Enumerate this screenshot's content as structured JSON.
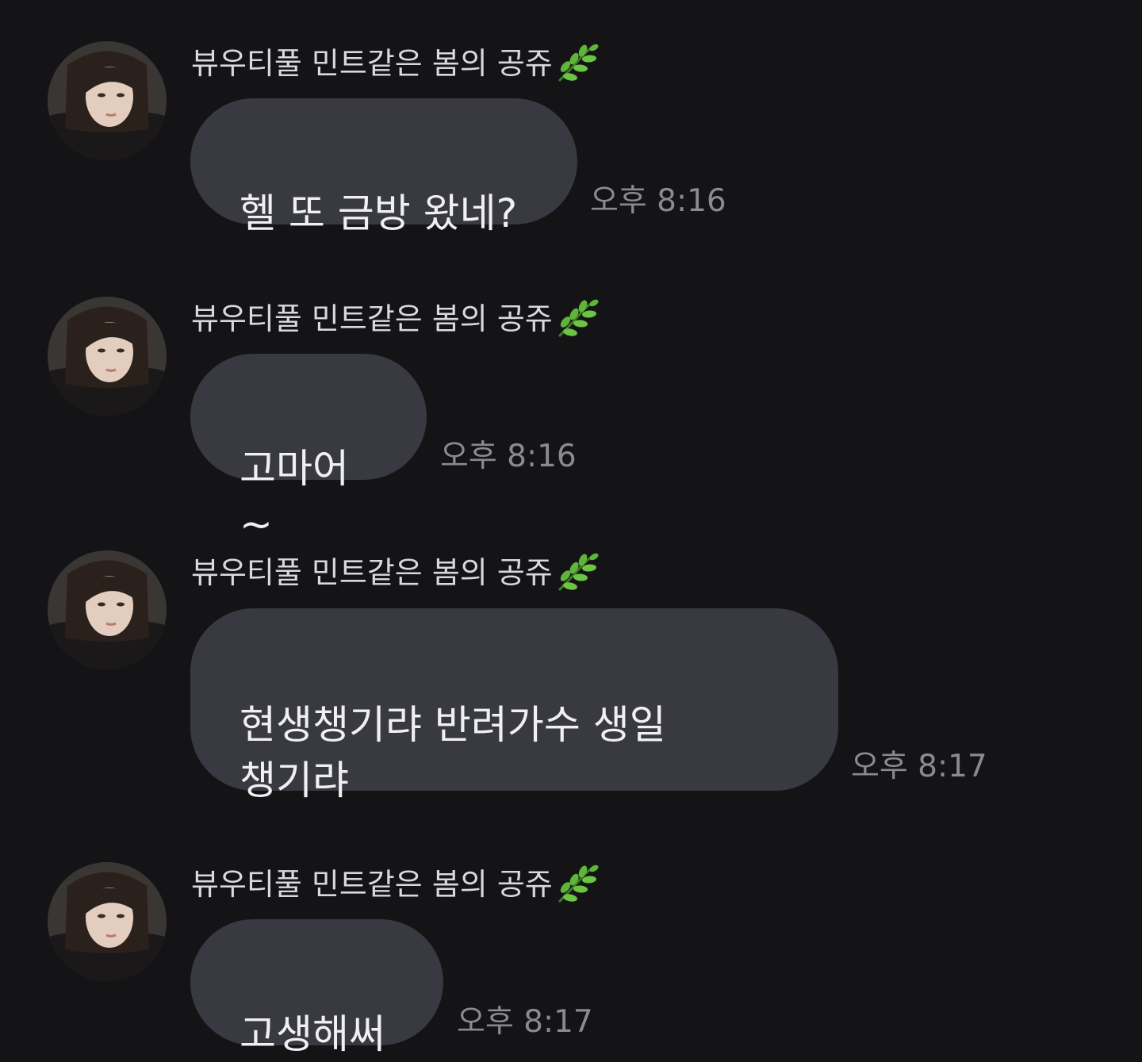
{
  "chat": {
    "messages": [
      {
        "sender": "뷰우티풀 민트같은 봄의 공쥬",
        "sender_emoji": "herb-icon",
        "text": "헬 또 금방 왔네?",
        "time": "오후 8:16"
      },
      {
        "sender": "뷰우티풀 민트같은 봄의 공쥬",
        "sender_emoji": "herb-icon",
        "text": "고마어~",
        "time": "오후 8:16"
      },
      {
        "sender": "뷰우티풀 민트같은 봄의 공쥬",
        "sender_emoji": "herb-icon",
        "text": "현생챙기랴 반려가수 생일\n챙기랴",
        "time": "오후 8:17"
      },
      {
        "sender": "뷰우티풀 민트같은 봄의 공쥬",
        "sender_emoji": "herb-icon",
        "text": "고생해써",
        "time": "오후 8:17"
      }
    ]
  },
  "colors": {
    "background": "#141417",
    "bubble": "#393a41",
    "sender_text": "#d9d9dc",
    "message_text": "#f0f0f2",
    "time_text": "#8a8a8f",
    "leaf_green": "#5fb43a"
  }
}
